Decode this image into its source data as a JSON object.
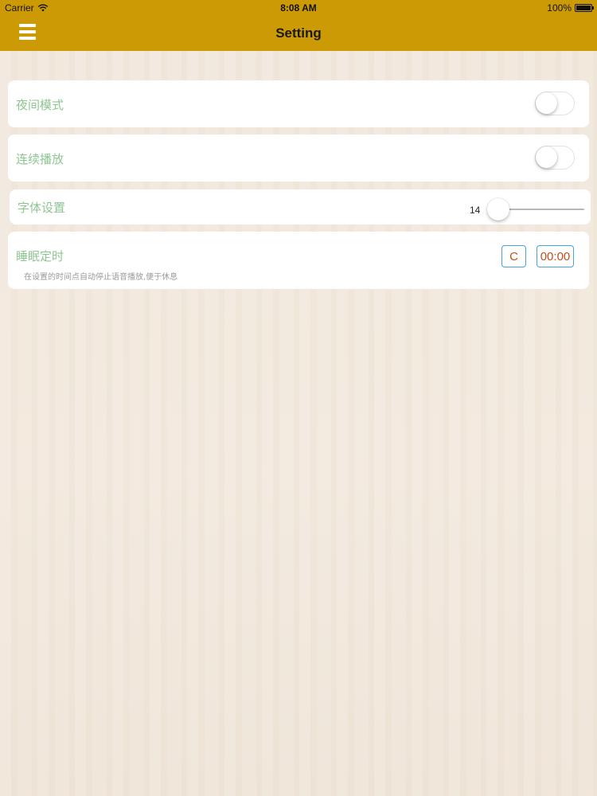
{
  "status_bar": {
    "carrier": "Carrier",
    "time": "8:08 AM",
    "battery": "100%"
  },
  "nav": {
    "title": "Setting",
    "menu_icon": "hamburger-menu-icon"
  },
  "settings": {
    "night_mode": {
      "label": "夜间模式",
      "enabled": false
    },
    "continuous_play": {
      "label": "连续播放",
      "enabled": false
    },
    "font": {
      "label": "字体设置",
      "value": "14",
      "slider_position": 0
    },
    "sleep_timer": {
      "label": "睡眠定时",
      "clear_label": "C",
      "time_value": "00:00",
      "description": "在设置的时间点自动停止语音播放,便于休息"
    }
  },
  "colors": {
    "nav_bar": "#cc9a05",
    "label_text": "#8fc592",
    "button_border": "#4aa3d8",
    "button_text": "#c0501a"
  }
}
